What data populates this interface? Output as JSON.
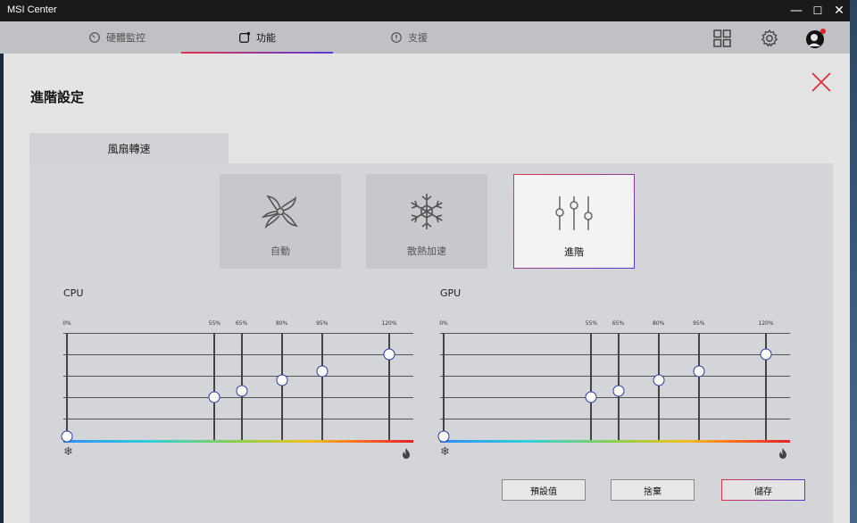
{
  "app": {
    "title": "MSI Center"
  },
  "window_controls": {
    "minimize": "—",
    "maximize": "☐",
    "close": "✕"
  },
  "nav": {
    "tabs": [
      {
        "label": "硬體監控",
        "icon": "gauge-icon"
      },
      {
        "label": "功能",
        "icon": "feature-icon",
        "active": true
      },
      {
        "label": "支援",
        "icon": "support-icon"
      }
    ],
    "right_icons": [
      "grid-icon",
      "settings-gear-icon",
      "profile-avatar-icon"
    ]
  },
  "page": {
    "title": "進階設定"
  },
  "subtab": {
    "label": "風扇轉速"
  },
  "modes": [
    {
      "label": "自動",
      "icon": "fan-icon"
    },
    {
      "label": "散熱加速",
      "icon": "snowflake-icon"
    },
    {
      "label": "進階",
      "icon": "sliders-icon",
      "active": true
    }
  ],
  "curves": [
    {
      "title": "CPU",
      "points": [
        {
          "label": "0%",
          "value_percent": 0,
          "level": 0
        },
        {
          "label": "55%",
          "value_percent": 55,
          "level": 2
        },
        {
          "label": "65%",
          "value_percent": 65,
          "level": 2.3
        },
        {
          "label": "80%",
          "value_percent": 80,
          "level": 2.8
        },
        {
          "label": "95%",
          "value_percent": 95,
          "level": 3.2
        },
        {
          "label": "120%",
          "value_percent": 120,
          "level": 4
        }
      ]
    },
    {
      "title": "GPU",
      "points": [
        {
          "label": "0%",
          "value_percent": 0,
          "level": 0
        },
        {
          "label": "55%",
          "value_percent": 55,
          "level": 2
        },
        {
          "label": "65%",
          "value_percent": 65,
          "level": 2.3
        },
        {
          "label": "80%",
          "value_percent": 80,
          "level": 2.8
        },
        {
          "label": "95%",
          "value_percent": 95,
          "level": 3.2
        },
        {
          "label": "120%",
          "value_percent": 120,
          "level": 4
        }
      ]
    }
  ],
  "buttons": {
    "default": "預設值",
    "discard": "捨棄",
    "save": "儲存"
  },
  "colors": {
    "accent_red": "#e0344a",
    "accent_blue": "#4a3bd8",
    "point_border": "#2a3aa8"
  }
}
